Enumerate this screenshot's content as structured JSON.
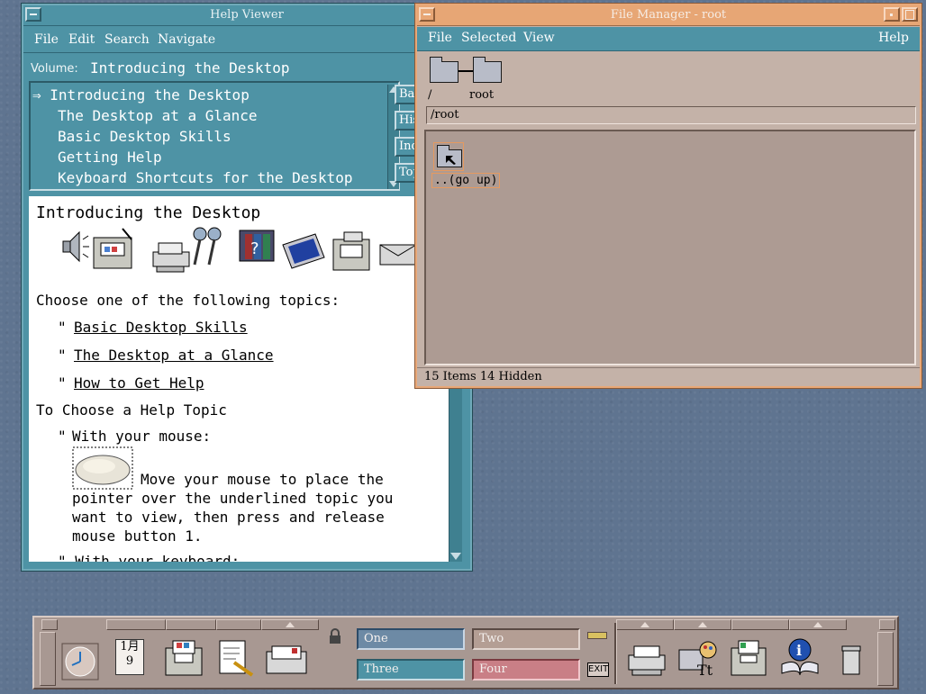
{
  "help_viewer": {
    "title": "Help Viewer",
    "menu": [
      "File",
      "Edit",
      "Search",
      "Navigate"
    ],
    "volume_label": "Volume:",
    "volume_value": "Introducing the Desktop",
    "toc": [
      "⇒ Introducing the Desktop",
      "The Desktop at a Glance",
      "Basic Desktop Skills",
      "Getting Help",
      "Keyboard Shortcuts for the Desktop"
    ],
    "side_buttons": [
      "Back",
      "History",
      "Index",
      "Top Level"
    ],
    "content": {
      "title": "Introducing the Desktop",
      "choose_text": "Choose one of the following topics:",
      "links": [
        "Basic Desktop Skills",
        "The Desktop at a Glance",
        "How to Get Help"
      ],
      "bullet": "\"",
      "section_title": "To Choose a Help Topic",
      "with_mouse": "With your mouse:",
      "instruction_lines": [
        "Move your mouse to place the",
        "pointer over the underlined topic you",
        "want to view, then press and release",
        "mouse button 1."
      ],
      "cutoff_line": "\" With your keyboard:"
    }
  },
  "file_manager": {
    "title": "File Manager - root",
    "menu": [
      "File",
      "Selected",
      "View"
    ],
    "help_menu": "Help",
    "path_root": "/",
    "path_folder": "root",
    "path_field": "/root",
    "go_up_label": "..(go up)",
    "status": "15 Items 14 Hidden"
  },
  "front_panel": {
    "calendar_month": "1月",
    "calendar_day": "9",
    "workspaces": [
      "One",
      "Two",
      "Three",
      "Four"
    ],
    "exit_label": "EXIT"
  }
}
